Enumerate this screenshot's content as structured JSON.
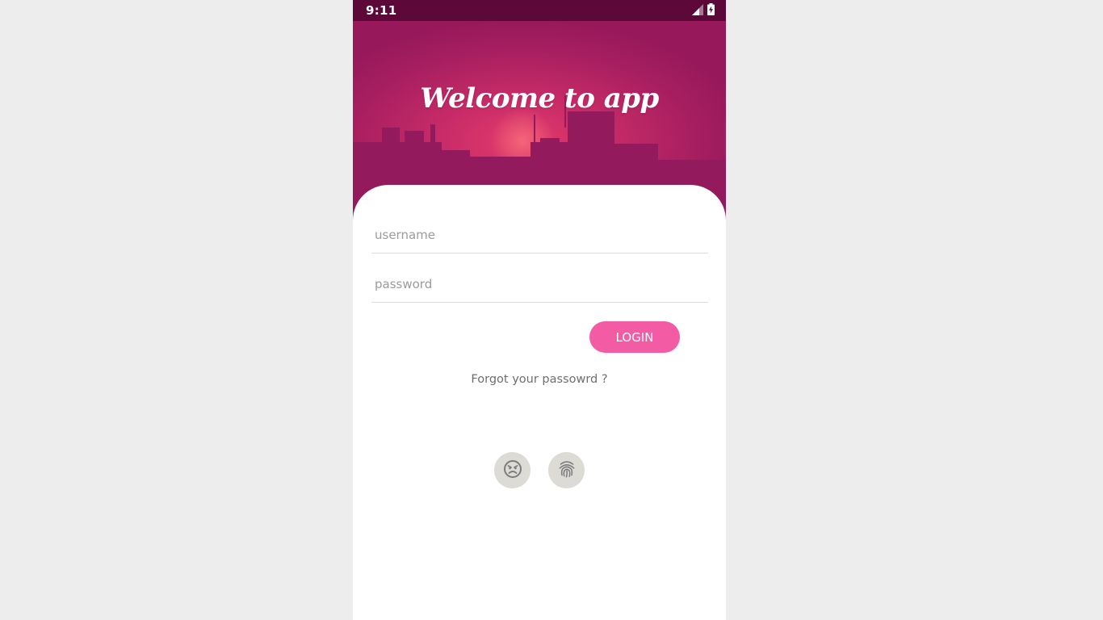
{
  "status_bar": {
    "time": "9:11",
    "icons": [
      "signal-icon",
      "battery-charging-icon"
    ]
  },
  "header": {
    "title": "Welcome to app"
  },
  "login_form": {
    "username_placeholder": "username",
    "username_value": "",
    "password_placeholder": "password",
    "password_value": "",
    "login_label": "LOGIN",
    "forgot_label": "Forgot your passowrd ?"
  },
  "alt_login": {
    "face_icon": "face-recognition-icon",
    "fingerprint_icon": "fingerprint-icon"
  },
  "colors": {
    "status_bar": "#5c0838",
    "header_dark": "#97195c",
    "header_glow": "#e33a6b",
    "accent": "#f35ba4",
    "circle_button": "#dcdbd6",
    "page_background": "#ededed"
  }
}
